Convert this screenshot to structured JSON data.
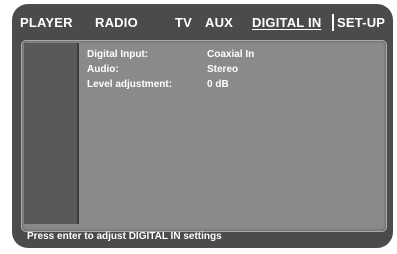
{
  "tabs": [
    {
      "label": "PLAYER"
    },
    {
      "label": "RADIO"
    },
    {
      "label": "TV"
    },
    {
      "label": "AUX"
    },
    {
      "label": "DIGITAL IN",
      "active": true
    },
    {
      "label": "SET-UP"
    }
  ],
  "settings": [
    {
      "label": "Digital Input:",
      "value": "Coaxial In"
    },
    {
      "label": "Audio:",
      "value": "Stereo"
    },
    {
      "label": "Level adjustment:",
      "value": "0 dB"
    }
  ],
  "status": {
    "hint": "Press enter to adjust DIGITAL IN settings"
  },
  "colors": {
    "frame": "#4b4b4b",
    "panel": "#8a8a8a",
    "sidebar": "#595959",
    "text": "#ffffff"
  }
}
